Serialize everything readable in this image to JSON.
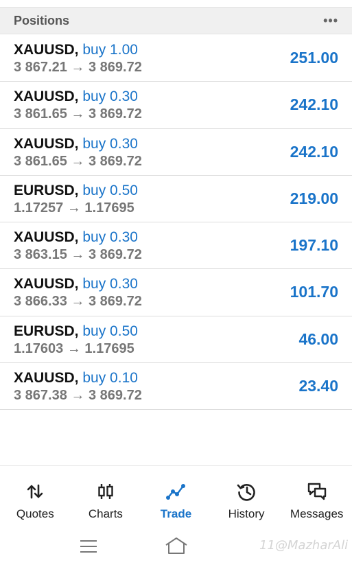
{
  "header": {
    "title": "Positions",
    "more": "•••"
  },
  "positions": [
    {
      "symbol": "XAUUSD,",
      "side": "buy 1.00",
      "prices": "3 867.21 → 3 869.72",
      "profit": "251.00"
    },
    {
      "symbol": "XAUUSD,",
      "side": "buy 0.30",
      "prices": "3 861.65 → 3 869.72",
      "profit": "242.10"
    },
    {
      "symbol": "XAUUSD,",
      "side": "buy 0.30",
      "prices": "3 861.65 → 3 869.72",
      "profit": "242.10"
    },
    {
      "symbol": "EURUSD,",
      "side": "buy 0.50",
      "prices": "1.17257 → 1.17695",
      "profit": "219.00"
    },
    {
      "symbol": "XAUUSD,",
      "side": "buy 0.30",
      "prices": "3 863.15 → 3 869.72",
      "profit": "197.10"
    },
    {
      "symbol": "XAUUSD,",
      "side": "buy 0.30",
      "prices": "3 866.33 → 3 869.72",
      "profit": "101.70"
    },
    {
      "symbol": "EURUSD,",
      "side": "buy 0.50",
      "prices": "1.17603 → 1.17695",
      "profit": "46.00"
    },
    {
      "symbol": "XAUUSD,",
      "side": "buy 0.10",
      "prices": "3 867.38 → 3 869.72",
      "profit": "23.40"
    }
  ],
  "tabs": [
    {
      "label": "Quotes",
      "icon": "quotes-arrows-icon"
    },
    {
      "label": "Charts",
      "icon": "candlestick-icon"
    },
    {
      "label": "Trade",
      "icon": "trend-line-icon",
      "active": true
    },
    {
      "label": "History",
      "icon": "history-icon"
    },
    {
      "label": "Messages",
      "icon": "chat-bubbles-icon"
    }
  ],
  "watermark": "11@MazharAli",
  "colors": {
    "accent": "#1a74c9",
    "text": "#111111",
    "muted": "#777777"
  }
}
